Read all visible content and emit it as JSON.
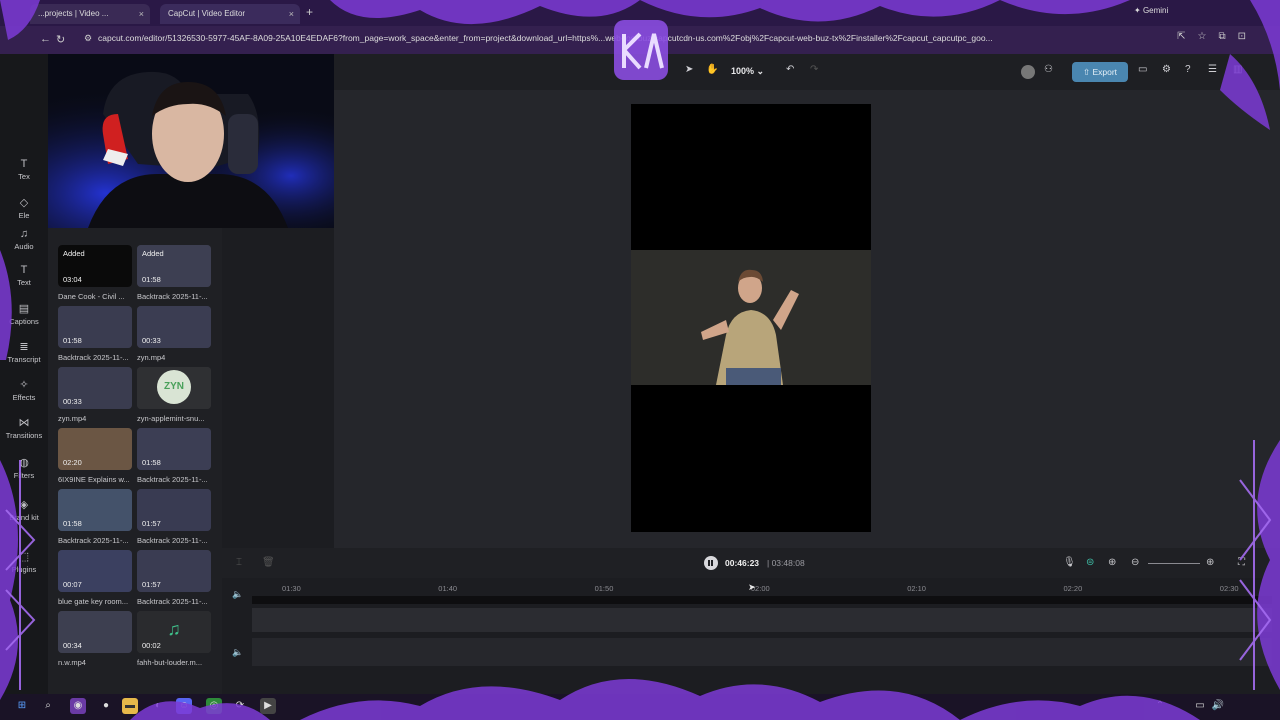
{
  "browser": {
    "tabs": [
      {
        "label": "...projects | Video ..."
      },
      {
        "label": "CapCut | Video Editor"
      }
    ],
    "gemini_label": "Gemini",
    "url": "capcut.com/editor/51326530-5977-45AF-8A09-25A10E4EDAF6?from_page=work_space&enter_from=project&download_url=https%...web-tos-buz.capcutcdn-us.com%2Fobj%2Fcapcut-web-buz-tx%2Finstaller%2Fcapcut_capcutpc_goo..."
  },
  "toolbar": {
    "zoom": "100%",
    "export_label": "Export"
  },
  "rail": [
    {
      "label": "Tex",
      "icon": "text-icon"
    },
    {
      "label": "Ele",
      "icon": "elements-icon"
    },
    {
      "label": "Audio",
      "icon": "audio-icon"
    },
    {
      "label": "Text",
      "icon": "text-t-icon"
    },
    {
      "label": "Captions",
      "icon": "captions-icon"
    },
    {
      "label": "Transcript",
      "icon": "transcript-icon"
    },
    {
      "label": "Effects",
      "icon": "effects-icon"
    },
    {
      "label": "Transitions",
      "icon": "transitions-icon"
    },
    {
      "label": "Filters",
      "icon": "filters-icon"
    },
    {
      "label": "Brand kit",
      "icon": "brand-kit-icon"
    },
    {
      "label": "Plugins",
      "icon": "plugins-icon"
    }
  ],
  "media": [
    {
      "title": "Dane Cook - Civil ...",
      "duration": "03:04",
      "added": "Added"
    },
    {
      "title": "Backtrack 2025-11-...",
      "duration": "01:58",
      "added": "Added"
    },
    {
      "title": "Backtrack 2025-11-...",
      "duration": "01:58"
    },
    {
      "title": "zyn.mp4",
      "duration": "00:33"
    },
    {
      "title": "zyn.mp4",
      "duration": "00:33"
    },
    {
      "title": "zyn-applemint-snu...",
      "duration": "",
      "badge": "ZYN"
    },
    {
      "title": "6IX9INE Explains w...",
      "duration": "02:20"
    },
    {
      "title": "Backtrack 2025-11-...",
      "duration": "01:58"
    },
    {
      "title": "Backtrack 2025-11-...",
      "duration": "01:58"
    },
    {
      "title": "Backtrack 2025-11-...",
      "duration": "01:57"
    },
    {
      "title": "blue gate key room...",
      "duration": "00:07"
    },
    {
      "title": "Backtrack 2025-11-...",
      "duration": "01:57"
    },
    {
      "title": "n.w.mp4",
      "duration": "00:34"
    },
    {
      "title": "fahh-but-louder.m...",
      "duration": "00:02"
    }
  ],
  "player": {
    "current_time": "00:46:23",
    "total_time": "03:48:08"
  },
  "timeline": {
    "ticks": [
      "01:30",
      "01:40",
      "01:50",
      "02:00",
      "02:10",
      "02:20",
      "02:30"
    ]
  },
  "colors": {
    "accent": "#4a86b0",
    "deco": "#7c3bd6"
  }
}
